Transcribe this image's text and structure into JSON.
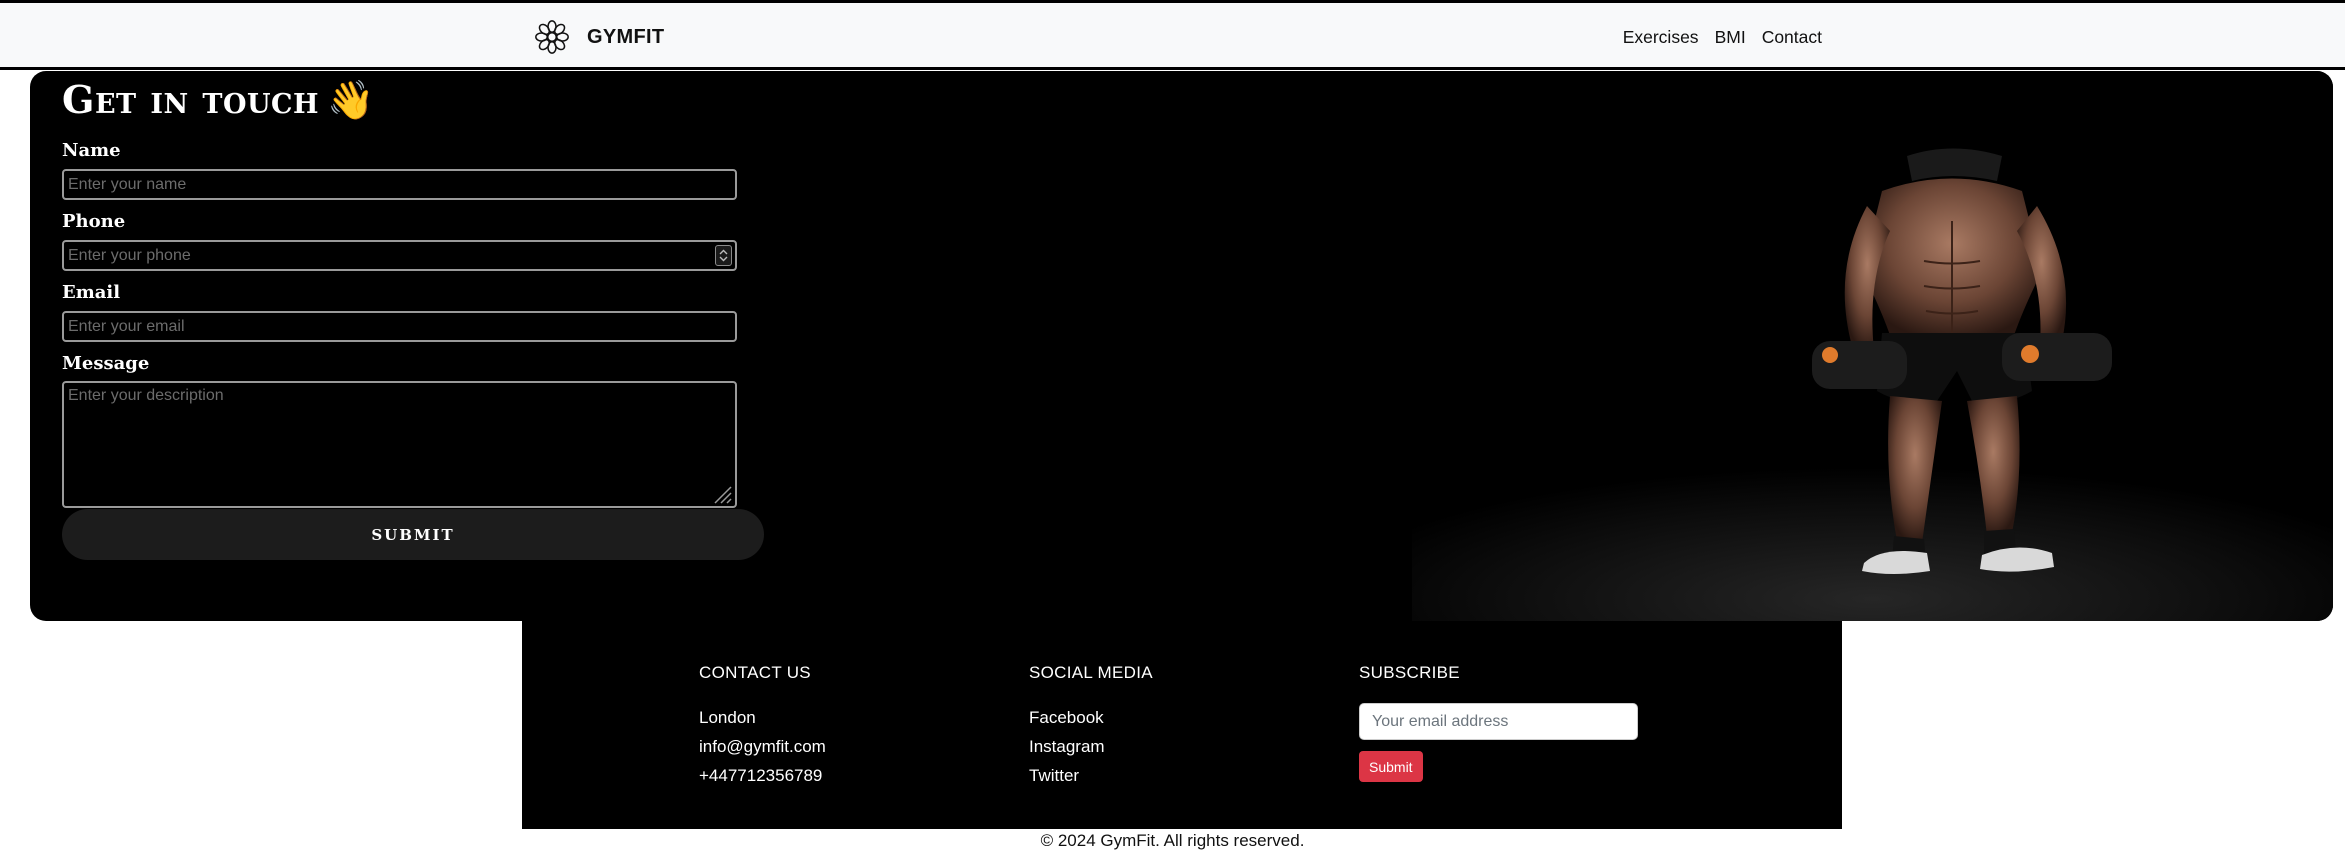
{
  "brand": {
    "name": "GYMFIT",
    "logo_icon": "lotus-mandala-icon"
  },
  "nav": {
    "items": [
      {
        "label": "Exercises"
      },
      {
        "label": "BMI"
      },
      {
        "label": "Contact"
      }
    ]
  },
  "contact_form": {
    "title": "Get in touch",
    "title_emoji": "👋",
    "fields": {
      "name": {
        "label": "Name",
        "placeholder": "Enter your name",
        "value": ""
      },
      "phone": {
        "label": "Phone",
        "placeholder": "Enter your phone",
        "value": ""
      },
      "email": {
        "label": "Email",
        "placeholder": "Enter your email",
        "value": ""
      },
      "message": {
        "label": "Message",
        "placeholder": "Enter your description",
        "value": ""
      }
    },
    "submit_label": "SUBMIT",
    "hero_image": "muscular-man-holding-dumbbells-photo"
  },
  "footer": {
    "contact": {
      "heading": "CONTACT US",
      "items": [
        "London",
        "info@gymfit.com",
        "+447712356789"
      ]
    },
    "social": {
      "heading": "SOCIAL MEDIA",
      "items": [
        "Facebook",
        "Instagram",
        "Twitter"
      ]
    },
    "subscribe": {
      "heading": "SUBSCRIBE",
      "placeholder": "Your email address",
      "button_label": "Submit"
    },
    "copyright": "© 2024 GymFit. All rights reserved."
  },
  "colors": {
    "navbar_bg": "#f8f9fa",
    "card_bg": "#000000",
    "submit_bg": "#1c1c1c",
    "subscribe_button": "#dc3545"
  }
}
